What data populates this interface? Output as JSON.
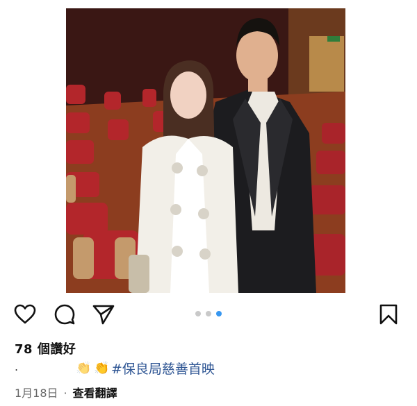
{
  "post": {
    "photo": {
      "icon": "photo-image",
      "description_colors": {
        "seat_red": "#b3262b",
        "theatre_wall": "#3a1714",
        "floor": "#8c3d1f",
        "jacket_white": "#f2efe8",
        "suit_black": "#1c1c1f"
      }
    },
    "actions": {
      "like_icon": "heart-icon",
      "comment_icon": "comment-icon",
      "share_icon": "paper-plane-icon",
      "save_icon": "bookmark-icon"
    },
    "carousel": {
      "count": 3,
      "active_index": 2,
      "active_color": "#3897f0",
      "inactive_color": "#c9c9c9"
    },
    "likes_text": "78 個讚好",
    "caption": {
      "lead": ".",
      "emoji": "👏👏",
      "hashtag": "#保良局慈善首映"
    },
    "date": "1月18日",
    "separator": "·",
    "translate_label": "查看翻譯"
  }
}
